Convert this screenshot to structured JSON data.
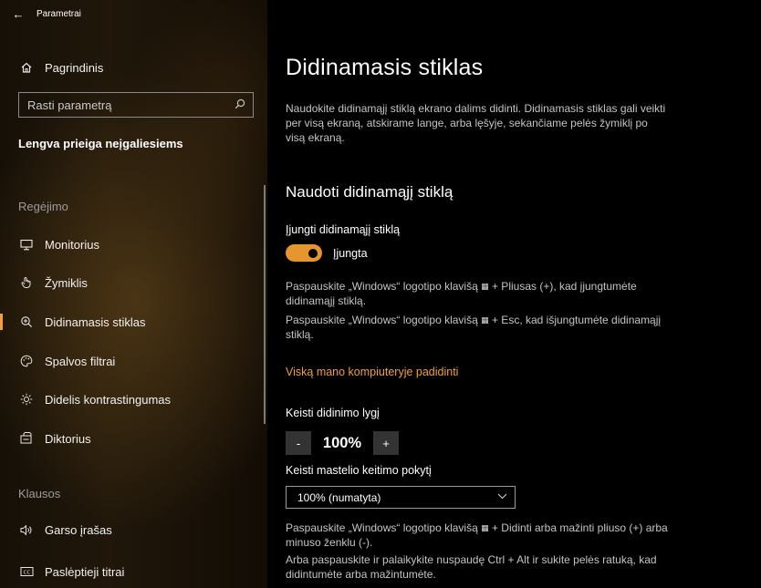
{
  "window": {
    "title": "Parametrai"
  },
  "sidebar": {
    "home": "Pagrindinis",
    "search_placeholder": "Rasti parametrą",
    "section_title": "Lengva prieiga neįgaliesiems",
    "groups": {
      "vision": "Regėjimo",
      "hearing": "Klausos"
    },
    "items": [
      {
        "label": "Monitorius",
        "icon": "monitor-icon"
      },
      {
        "label": "Žymiklis",
        "icon": "pointer-icon"
      },
      {
        "label": "Didinamasis stiklas",
        "icon": "magnifier-icon",
        "active": true
      },
      {
        "label": "Spalvos filtrai",
        "icon": "palette-icon"
      },
      {
        "label": "Didelis kontrastingumas",
        "icon": "brightness-icon"
      },
      {
        "label": "Diktorius",
        "icon": "narrator-icon"
      },
      {
        "label": "Garso įrašas",
        "icon": "speaker-icon"
      },
      {
        "label": "Paslėptieji titrai",
        "icon": "captions-icon"
      }
    ]
  },
  "main": {
    "title": "Didinamasis stiklas",
    "description": "Naudokite didinamąjį stiklą ekrano dalims didinti. Didinamasis stiklas gali veikti per visą ekraną, atskirame lange, arba lęšyje, sekančiame pelės žymiklį po visą ekraną.",
    "section_title": "Naudoti didinamąjį stiklą",
    "toggle_label": "Įjungti didinamąjį stiklą",
    "toggle_state": "Įjungta",
    "help_on_a": "Paspauskite „Windows“ logotipo klavišą",
    "help_on_b": "+ Pliusas (+), kad įjungtumėte didinamąjį stiklą.",
    "help_off_a": "Paspauskite „Windows“ logotipo klavišą",
    "help_off_b": "+ Esc, kad išjungtumėte didinamąjį stiklą.",
    "link": "Viską mano kompiuteryje padidinti",
    "zoom_label": "Keisti didinimo lygį",
    "zoom_minus": "-",
    "zoom_value": "100%",
    "zoom_plus": "+",
    "increment_label": "Keisti mastelio keitimo pokytį",
    "increment_value": "100% (numatyta)",
    "help_zoom_a": "Paspauskite „Windows“ logotipo klavišą",
    "help_zoom_b": "+ Didinti arba mažinti pliuso (+) arba minuso ženklu (-).",
    "help_zoom_c": "Arba paspauskite ir palaikykite nuspaudę Ctrl + Alt ir sukite pelės ratuką, kad didintumėte arba mažintumėte.",
    "accent_color": "#f0a03c"
  }
}
